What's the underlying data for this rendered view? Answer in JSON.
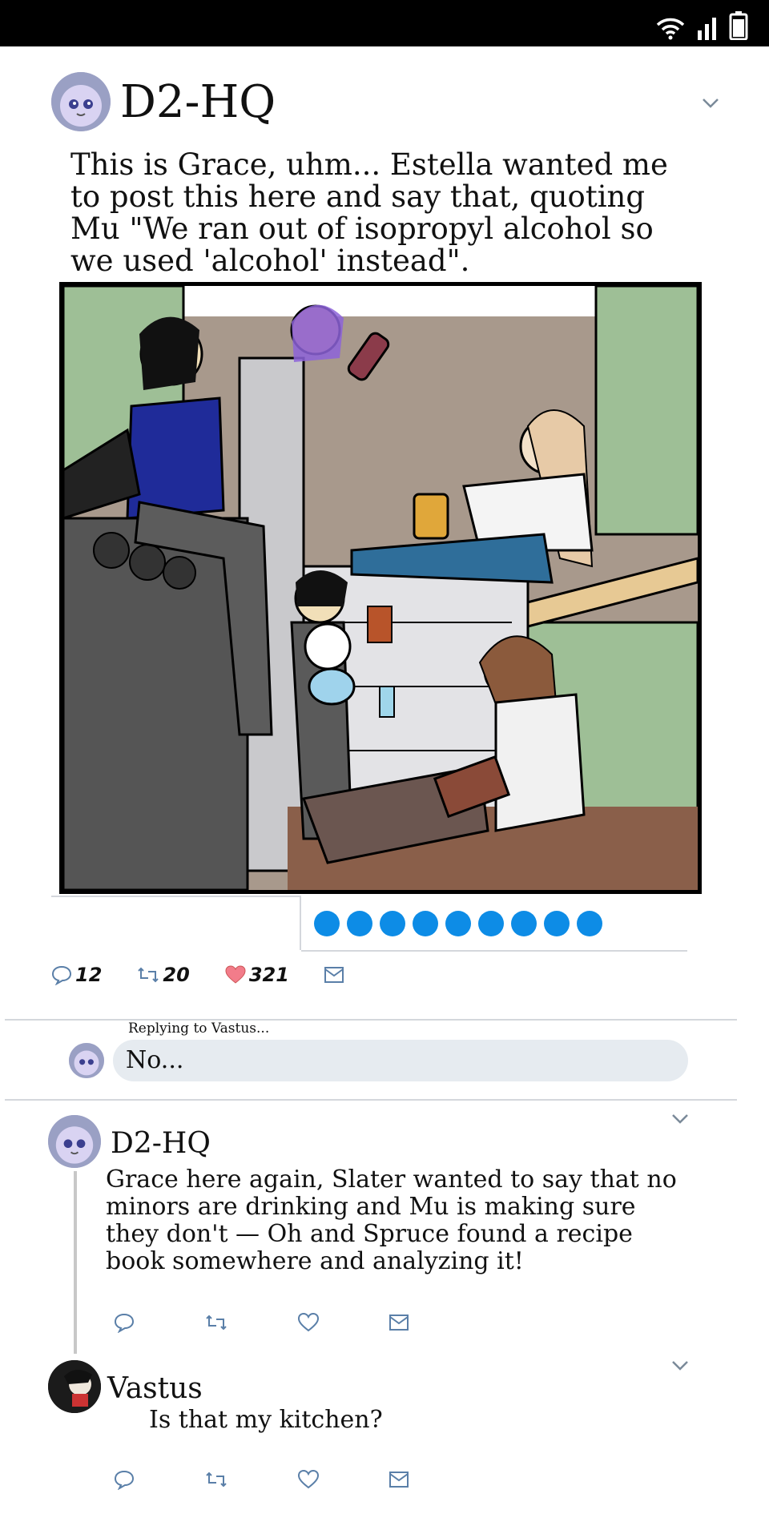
{
  "status_bar": {
    "icons": [
      "wifi-icon",
      "signal-icon",
      "battery-icon"
    ]
  },
  "post": {
    "author": "D2-HQ",
    "text": "This is Grace, uhm... Estella wanted me to post this here and say that, quoting Mu \"We ran out of isopropyl alcohol so we used 'alcohol' instead\".",
    "image_description_icon": "drawing",
    "page_dots": 9,
    "counts": {
      "replies": "12",
      "retweets": "20",
      "likes": "321"
    }
  },
  "reply_composer": {
    "label": "Replying to Vastus...",
    "value": "No..."
  },
  "replies": [
    {
      "author": "D2-HQ",
      "text": "Grace here again, Slater wanted to say that no minors are drinking and Mu is making sure they don't — Oh and Spruce found a recipe book somewhere and analyzing it!"
    },
    {
      "author": "Vastus",
      "text": "Is that my kitchen?"
    }
  ],
  "colors": {
    "accent": "#0d8ce6",
    "heart": "#f27c8a",
    "cabinet_green": "#9ebf96",
    "wall": "#a8998c"
  }
}
